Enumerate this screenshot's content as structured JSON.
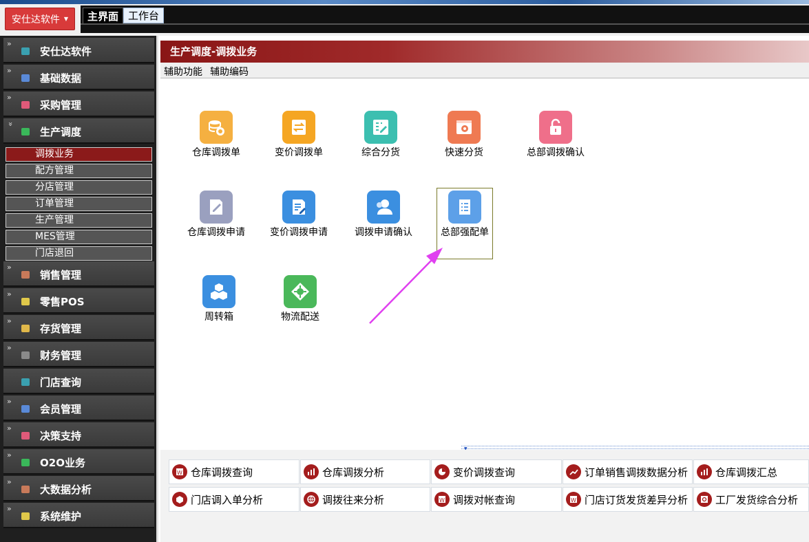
{
  "topbar": {
    "brand_label": "安仕达软件",
    "tabs": [
      "主界面",
      "工作台"
    ]
  },
  "sidebar": {
    "menu": [
      {
        "label": "安仕达软件",
        "color": "#3aa0b0"
      },
      {
        "label": "基础数据",
        "color": "#5a8ad8"
      },
      {
        "label": "采购管理",
        "color": "#e05a7a"
      },
      {
        "label": "生产调度",
        "color": "#3ab85a"
      },
      {
        "label": "销售管理",
        "color": "#c87a5a"
      },
      {
        "label": "零售POS",
        "color": "#e0c84a"
      },
      {
        "label": "存货管理",
        "color": "#e0b84a"
      },
      {
        "label": "财务管理",
        "color": "#8a8a8a"
      },
      {
        "label": "门店查询",
        "color": "#3aa0b0"
      },
      {
        "label": "会员管理",
        "color": "#5a8ad8"
      },
      {
        "label": "决策支持",
        "color": "#e05a7a"
      },
      {
        "label": "O2O业务",
        "color": "#3ab85a"
      },
      {
        "label": "大数据分析",
        "color": "#c87a5a"
      },
      {
        "label": "系统维护",
        "color": "#e0c84a"
      }
    ],
    "submenu": [
      "调拨业务",
      "配方管理",
      "分店管理",
      "订单管理",
      "生产管理",
      "MES管理",
      "门店退回"
    ]
  },
  "main": {
    "title": "生产调度-调拨业务",
    "toolbar": [
      "辅助功能",
      "辅助编码"
    ],
    "functions": [
      {
        "label": "仓库调拨单",
        "icon": "database-icon",
        "color": "#f5b041"
      },
      {
        "label": "变价调拨单",
        "icon": "swap-icon",
        "color": "#f5a623"
      },
      {
        "label": "综合分货",
        "icon": "edit-grid-icon",
        "color": "#3cbfb0"
      },
      {
        "label": "快速分货",
        "icon": "gear-window-icon",
        "color": "#ef7a52"
      },
      {
        "label": "总部调拨确认",
        "icon": "unlock-icon",
        "color": "#ef6f8a"
      },
      {
        "label": "仓库调拨申请",
        "icon": "pencil-doc-icon",
        "color": "#9aa0bf"
      },
      {
        "label": "变价调拨申请",
        "icon": "edit-doc-icon",
        "color": "#3b8fe0"
      },
      {
        "label": "调拨申请确认",
        "icon": "user-icon",
        "color": "#3b8fe0"
      },
      {
        "label": "总部强配单",
        "icon": "list-doc-icon",
        "color": "#5da0e8"
      },
      {
        "label": "周转箱",
        "icon": "boxes-icon",
        "color": "#3b8fe0"
      },
      {
        "label": "物流配送",
        "icon": "logistics-icon",
        "color": "#4ab85a"
      }
    ],
    "quick_links": [
      {
        "label": "仓库调拨查询",
        "icon": "report-w-icon"
      },
      {
        "label": "仓库调拨分析",
        "icon": "bar-chart-icon"
      },
      {
        "label": "变价调拨查询",
        "icon": "pie-chart-icon"
      },
      {
        "label": "订单销售调拨数据分析",
        "icon": "trend-chart-icon"
      },
      {
        "label": "仓库调拨汇总",
        "icon": "bar-chart-icon"
      },
      {
        "label": "门店调入单分析",
        "icon": "box-icon"
      },
      {
        "label": "调拨往来分析",
        "icon": "globe-icon"
      },
      {
        "label": "调拨对帐查询",
        "icon": "report-w-icon"
      },
      {
        "label": "门店订货发货差异分析",
        "icon": "report-w-icon"
      },
      {
        "label": "工厂发货综合分析",
        "icon": "search-doc-icon"
      }
    ]
  }
}
